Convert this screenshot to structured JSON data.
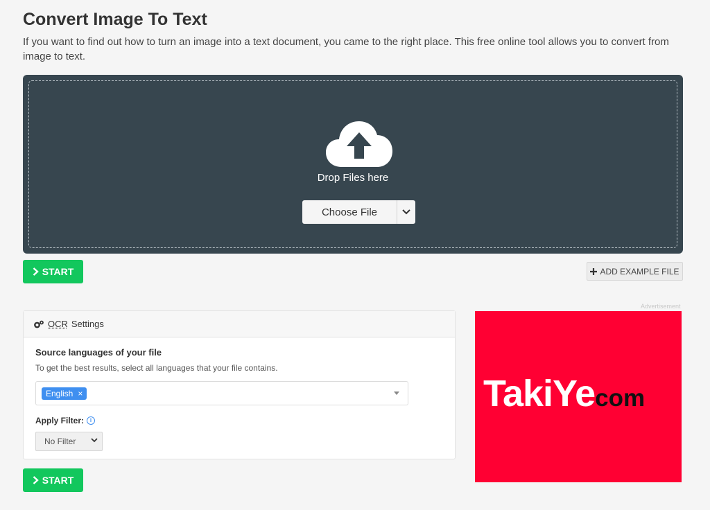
{
  "page": {
    "title": "Convert Image To Text",
    "description": "If you want to find out how to turn an image into a text document, you came to the right place. This free online tool allows you to convert from image to text."
  },
  "dropzone": {
    "icon": "cloud-upload-icon",
    "drop_text": "Drop Files here",
    "choose_label": "Choose File",
    "dropdown_icon": "chevron-down-icon",
    "background_color": "#37464f"
  },
  "actions": {
    "start_label": "START",
    "start_icon": "chevron-right-icon",
    "start_color": "#12c75d",
    "add_example_label": "ADD EXAMPLE FILE",
    "add_example_icon": "plus-icon"
  },
  "ocr_settings": {
    "header_icon": "gears-icon",
    "header_ocr": "OCR",
    "header_rest": "Settings",
    "source_title": "Source languages of your file",
    "source_desc": "To get the best results, select all languages that your file contains.",
    "selected_languages": [
      "English"
    ],
    "tag_remove": "×",
    "filter_label": "Apply Filter:",
    "filter_info_icon": "info-icon",
    "filter_value": "No Filter"
  },
  "ad": {
    "label": "Advertisement",
    "brand_main": "TakiYe",
    "brand_suffix": "com",
    "background_color": "#ff0033"
  }
}
